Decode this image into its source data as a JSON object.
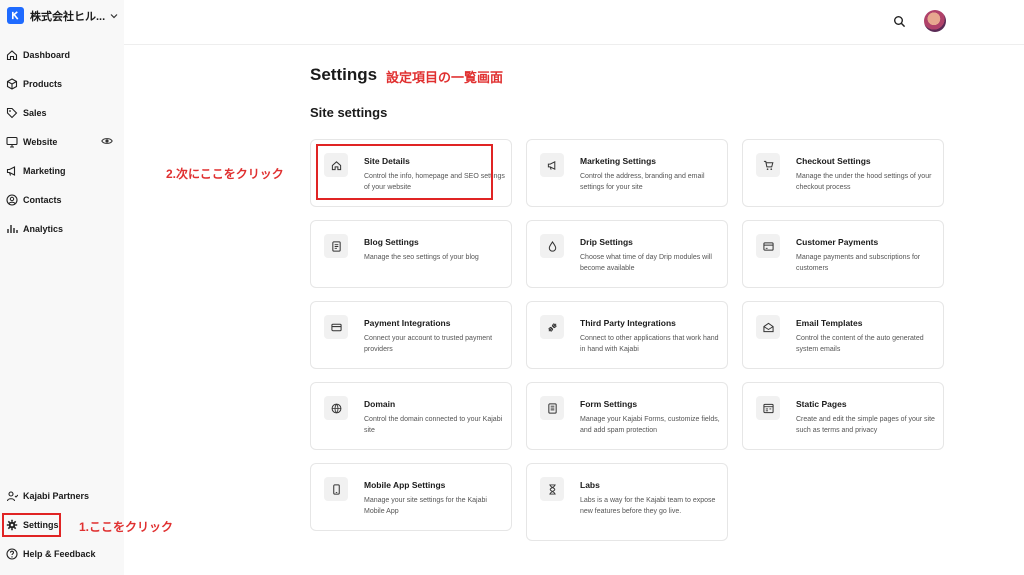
{
  "brand": {
    "name": "株式会社ヒル..."
  },
  "sidebar": {
    "items": [
      {
        "label": "Dashboard",
        "icon": "home-icon"
      },
      {
        "label": "Products",
        "icon": "box-icon"
      },
      {
        "label": "Sales",
        "icon": "tag-icon"
      },
      {
        "label": "Website",
        "icon": "monitor-icon"
      },
      {
        "label": "Marketing",
        "icon": "megaphone-icon"
      },
      {
        "label": "Contacts",
        "icon": "contact-icon"
      },
      {
        "label": "Analytics",
        "icon": "chart-icon"
      }
    ],
    "bottom_items": [
      {
        "label": "Kajabi Partners",
        "icon": "partners-icon"
      },
      {
        "label": "Settings",
        "icon": "gear-icon"
      },
      {
        "label": "Help & Feedback",
        "icon": "help-icon"
      }
    ]
  },
  "header": {
    "title": "Settings",
    "annotation": "設定項目の一覧画面"
  },
  "section": {
    "title": "Site settings"
  },
  "annotations": {
    "step1": "1.ここをクリック",
    "step2": "2.次にここをクリック"
  },
  "colors": {
    "accent": "#1f6bff",
    "annotation": "#e02424"
  },
  "cards": [
    {
      "title": "Site Details",
      "desc": "Control the info, homepage and SEO settings of your website",
      "icon": "home-icon"
    },
    {
      "title": "Marketing Settings",
      "desc": "Control the address, branding and email settings for your site",
      "icon": "megaphone-icon"
    },
    {
      "title": "Checkout Settings",
      "desc": "Manage the under the hood settings of your checkout process",
      "icon": "cart-icon"
    },
    {
      "title": "Blog Settings",
      "desc": "Manage the seo settings of your blog",
      "icon": "blog-icon"
    },
    {
      "title": "Drip Settings",
      "desc": "Choose what time of day Drip modules will become available",
      "icon": "drop-icon"
    },
    {
      "title": "Customer Payments",
      "desc": "Manage payments and subscriptions for customers",
      "icon": "payments-icon"
    },
    {
      "title": "Payment Integrations",
      "desc": "Connect your account to trusted payment providers",
      "icon": "card-icon"
    },
    {
      "title": "Third Party Integrations",
      "desc": "Connect to other applications that work hand in hand with Kajabi",
      "icon": "plug-icon"
    },
    {
      "title": "Email Templates",
      "desc": "Control the content of the auto generated system emails",
      "icon": "email-icon"
    },
    {
      "title": "Domain",
      "desc": "Control the domain connected to your Kajabi site",
      "icon": "globe-icon"
    },
    {
      "title": "Form Settings",
      "desc": "Manage your Kajabi Forms, customize fields, and add spam protection",
      "icon": "form-icon"
    },
    {
      "title": "Static Pages",
      "desc": "Create and edit the simple pages of your site such as terms and privacy",
      "icon": "page-icon"
    },
    {
      "title": "Mobile App Settings",
      "desc": "Manage your site settings for the Kajabi Mobile App",
      "icon": "mobile-icon"
    },
    {
      "title": "Labs",
      "desc": "Labs is a way for the Kajabi team to expose new features before they go live.",
      "icon": "hourglass-icon"
    }
  ]
}
